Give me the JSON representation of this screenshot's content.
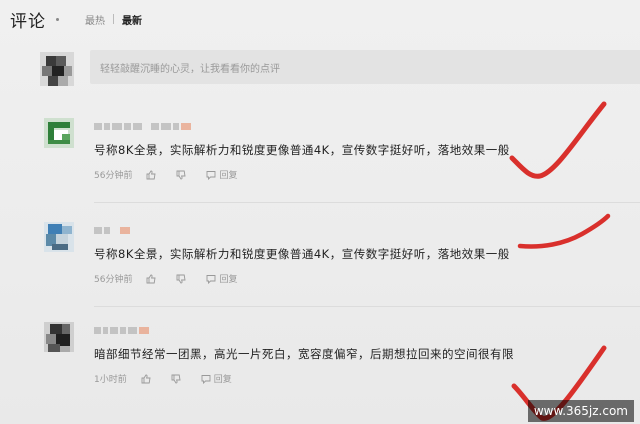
{
  "header": {
    "title": "评论",
    "tabs": [
      {
        "label": "最热",
        "active": false
      },
      {
        "label": "最新",
        "active": true
      }
    ]
  },
  "compose": {
    "placeholder": "轻轻敲醒沉睡的心灵，让我看看你的点评"
  },
  "comments": [
    {
      "text": "号称8K全景，实际解析力和锐度更像普通4K，宣传数字挺好听，落地效果一般",
      "time": "56分钟前",
      "reply_label": "回复",
      "annotated_check": true
    },
    {
      "text": "号称8K全景，实际解析力和锐度更像普通4K，宣传数字挺好听，落地效果一般",
      "time": "56分钟前",
      "reply_label": "回复",
      "annotated_check": true
    },
    {
      "text": "暗部细节经常一团黑，高光一片死白，宽容度偏窄，后期想拉回来的空间很有限",
      "time": "1小时前",
      "reply_label": "回复",
      "annotated_check": true
    }
  ],
  "watermark": "www.365jz.com",
  "colors": {
    "background": "#ededed",
    "check_red": "#d9302c",
    "muted_text": "#999999",
    "name_badge": "#e9a58a"
  },
  "icons": {
    "like": "thumbs-up-icon",
    "dislike": "thumbs-down-icon",
    "reply": "reply-bubble-icon"
  }
}
